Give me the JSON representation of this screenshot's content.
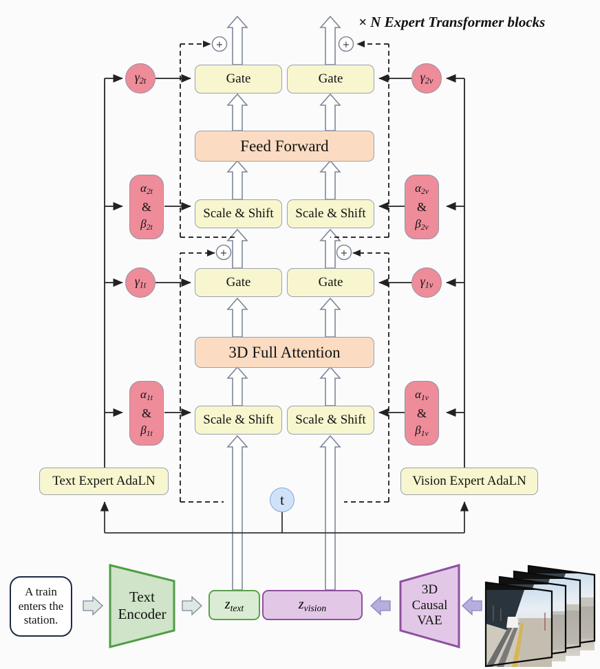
{
  "diagram": {
    "caption": "× N Expert Transformer blocks",
    "timestep_label": "t",
    "prompt_text": "A train enters the station.",
    "modules": {
      "feed_forward": "Feed Forward",
      "attention": "3D Full Attention",
      "gate": "Gate",
      "scale_shift": "Scale & Shift",
      "text_adaln": "Text Expert AdaLN",
      "vision_adaln": "Vision Expert AdaLN",
      "text_encoder": "Text\nEncoder",
      "text_encoder_l1": "Text",
      "text_encoder_l2": "Encoder",
      "vae_l1": "3D",
      "vae_l2": "Causal",
      "vae_l3": "VAE",
      "z_text": "z",
      "z_text_sub": "text",
      "z_vision": "z",
      "z_vision_sub": "vision"
    },
    "params": {
      "gamma": "γ",
      "alpha": "α",
      "beta": "β",
      "amp": "&",
      "gamma2t_sub": "2",
      "gamma2t_mod": "t",
      "gamma2v_mod": "v",
      "gamma1_sub": "1",
      "alpha2_sub": "2",
      "alpha1_sub": "1"
    },
    "plus_symbol": "+",
    "colors": {
      "yellow_fill": "#f8f6cf",
      "peach_fill": "#fbdcc2",
      "pink_fill": "#ee8c9a",
      "timestep_fill": "#cfe2f7",
      "green_fill": "#dbecd4",
      "green_stroke": "#5ba14f",
      "purple_fill": "#e2c8e6",
      "purple_stroke": "#8e4fa0",
      "arrow_stroke": "#7d8699",
      "line_stroke": "#333333",
      "background": "#fbfbfb"
    },
    "blocks": [
      {
        "name": "gate-ff-text",
        "label": "Gate"
      },
      {
        "name": "gate-ff-vision",
        "label": "Gate"
      },
      {
        "name": "feed-forward",
        "label": "Feed Forward"
      },
      {
        "name": "scale-shift-ff-text",
        "label": "Scale & Shift"
      },
      {
        "name": "scale-shift-ff-vision",
        "label": "Scale & Shift"
      },
      {
        "name": "gate-attn-text",
        "label": "Gate"
      },
      {
        "name": "gate-attn-vision",
        "label": "Gate"
      },
      {
        "name": "attention",
        "label": "3D Full Attention"
      },
      {
        "name": "scale-shift-attn-text",
        "label": "Scale & Shift"
      },
      {
        "name": "scale-shift-attn-vision",
        "label": "Scale & Shift"
      }
    ]
  }
}
